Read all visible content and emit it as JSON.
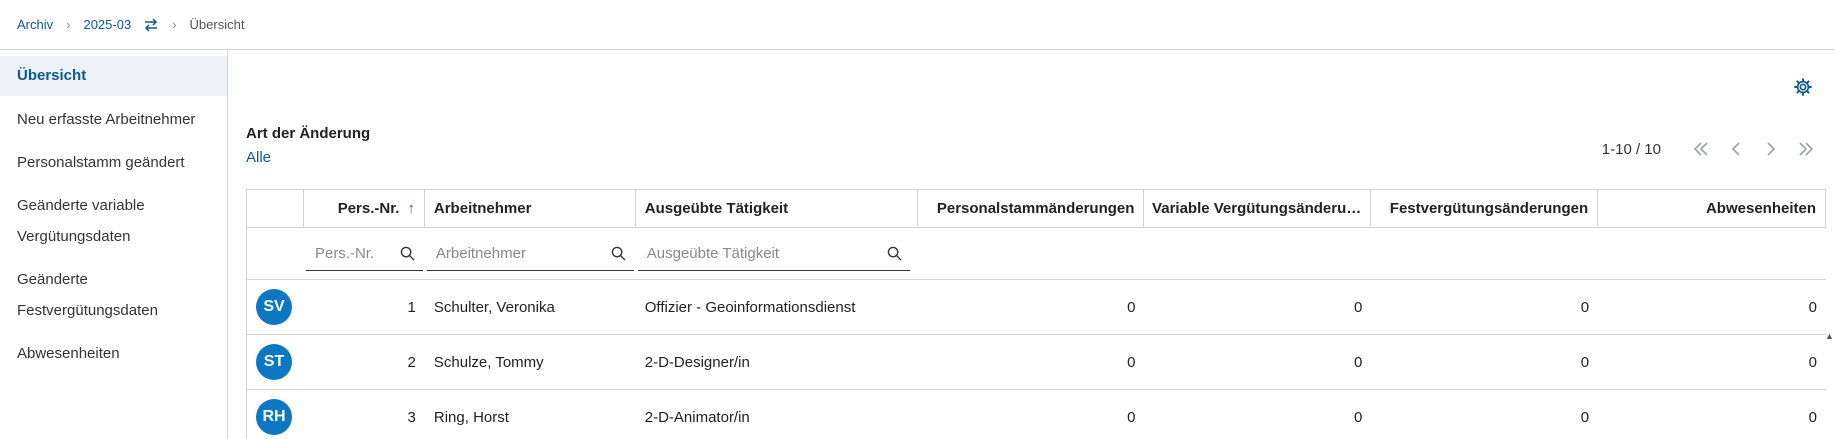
{
  "breadcrumb": {
    "archive": "Archiv",
    "period": "2025-03",
    "current": "Übersicht"
  },
  "sidebar": {
    "items": [
      {
        "label": "Übersicht"
      },
      {
        "label": "Neu erfasste Arbeitnehmer"
      },
      {
        "label": "Personalstamm geändert"
      },
      {
        "label": "Geänderte variable Vergütungsdaten"
      },
      {
        "label": "Geänderte Festvergütungsdaten"
      },
      {
        "label": "Abwesenheiten"
      }
    ]
  },
  "filter": {
    "title": "Art der Änderung",
    "value": "Alle"
  },
  "pager": {
    "info": "1-10 / 10"
  },
  "table": {
    "headers": {
      "pers_nr": "Pers.-Nr.",
      "sort_indicator": "↑",
      "employee": "Arbeitnehmer",
      "activity": "Ausgeübte Tätigkeit",
      "personnel_changes": "Personalstammänderungen",
      "variable_changes": "Variable Vergütungsänderu…",
      "fixed_changes": "Festvergütungsänderungen",
      "absences": "Abwesenheiten"
    },
    "filters": {
      "pers_nr_placeholder": "Pers.-Nr.",
      "employee_placeholder": "Arbeitnehmer",
      "activity_placeholder": "Ausgeübte Tätigkeit"
    },
    "rows": [
      {
        "initials": "SV",
        "pers_nr": "1",
        "name": "Schulter, Veronika",
        "activity": "Offizier - Geoinformationsdienst",
        "personnel": "0",
        "variable": "0",
        "fixed": "0",
        "absences": "0"
      },
      {
        "initials": "ST",
        "pers_nr": "2",
        "name": "Schulze, Tommy",
        "activity": "2-D-Designer/in",
        "personnel": "0",
        "variable": "0",
        "fixed": "0",
        "absences": "0"
      },
      {
        "initials": "RH",
        "pers_nr": "3",
        "name": "Ring, Horst",
        "activity": "2-D-Animator/in",
        "personnel": "0",
        "variable": "0",
        "fixed": "0",
        "absences": "0"
      }
    ]
  },
  "colors": {
    "accent": "#0c5a8e",
    "avatar": "#0c77c2",
    "active_bg": "#eef1f5"
  },
  "icons": [
    "swap-icon",
    "settings-gear-icon",
    "search-icon",
    "first-page-icon",
    "prev-page-icon",
    "next-page-icon",
    "last-page-icon",
    "sort-ascending-icon"
  ]
}
